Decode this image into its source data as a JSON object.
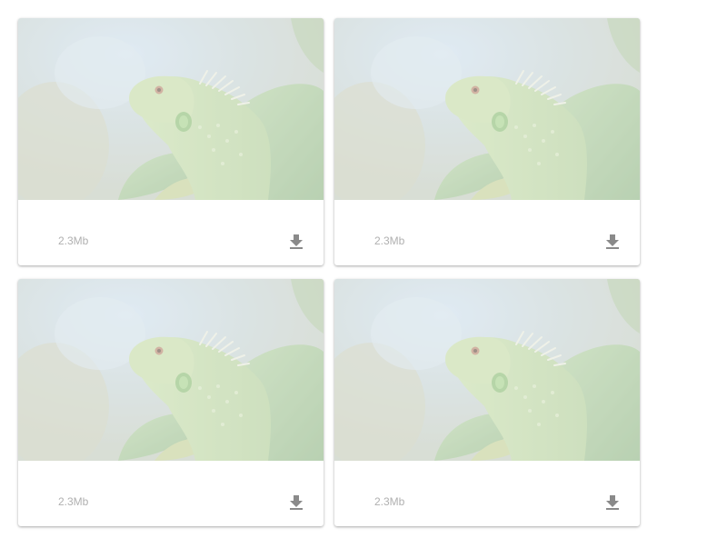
{
  "gallery": {
    "cards": [
      {
        "image": "iguana-photo",
        "size": "2.3Mb",
        "action_icon": "download-icon"
      },
      {
        "image": "iguana-photo",
        "size": "2.3Mb",
        "action_icon": "download-icon"
      },
      {
        "image": "iguana-photo",
        "size": "2.3Mb",
        "action_icon": "download-icon"
      },
      {
        "image": "iguana-photo",
        "size": "2.3Mb",
        "action_icon": "download-icon"
      }
    ]
  },
  "colors": {
    "size_text": "#b0b0b0",
    "icon": "#8a8a8a",
    "card_background": "#ffffff"
  }
}
